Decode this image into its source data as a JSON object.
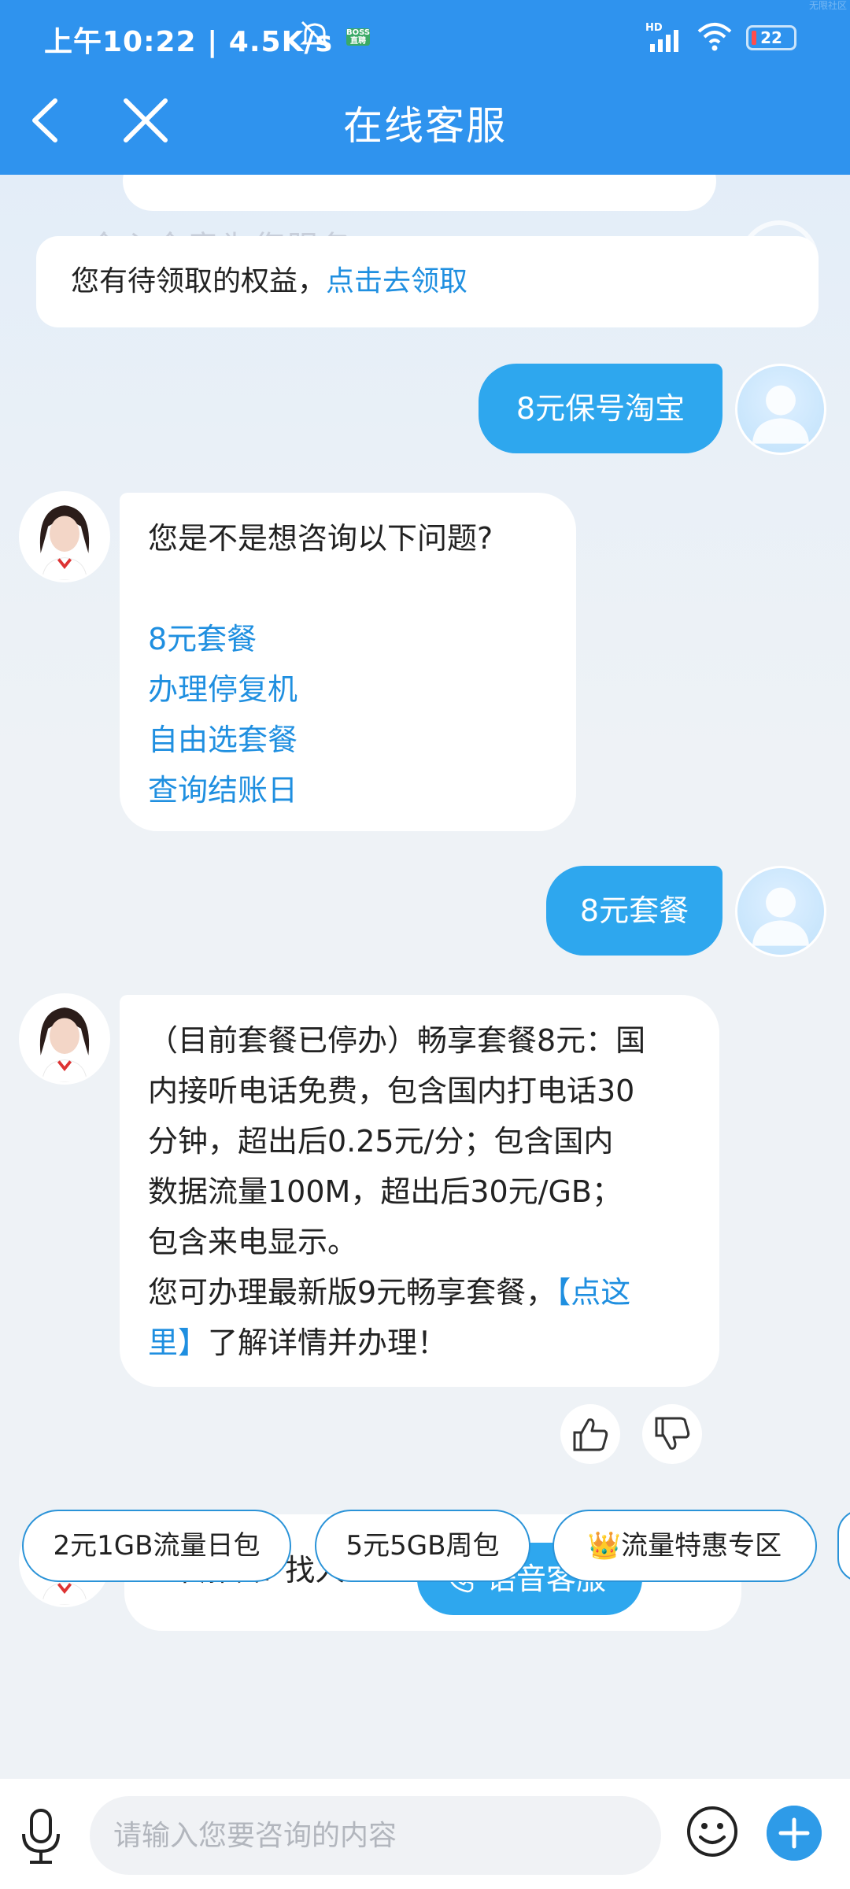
{
  "status_bar": {
    "time": "上午10:22 | 4.5K/s",
    "boss_badge": "BOSS\n直聘",
    "network_label": "HD",
    "battery": "22",
    "watermark": "无限社区"
  },
  "header": {
    "title": "在线客服",
    "back_icon": "chevron-left-icon",
    "close_icon": "close-icon"
  },
  "background_hint": "全心全意为您服务",
  "benefit_banner": {
    "text": "您有待领取的权益，",
    "link": "点击去领取"
  },
  "messages": [
    {
      "type": "user",
      "text": "8元保号淘宝"
    },
    {
      "type": "agent",
      "question": "您是不是想咨询以下问题?",
      "quick_links": [
        "8元套餐",
        "办理停复机",
        "自由选套餐",
        "查询结账日"
      ]
    },
    {
      "type": "user",
      "text": "8元套餐"
    },
    {
      "type": "agent",
      "lines": [
        "（目前套餐已停办）畅享套餐8元：国",
        "内接听电话免费，包含国内打电话30",
        "分钟，超出后0.25元/分；包含国内",
        "数据流量100M，超出后30元/GB；",
        "包含来电显示。",
        "您可办理最新版9元畅享套餐，"
      ],
      "link_part1": "【点这",
      "link_part2": "里】",
      "tail": "了解详情并办理！"
    },
    {
      "type": "agent_escalate",
      "text": "未解决? 找人工",
      "button": "语音客服"
    }
  ],
  "feedback": {
    "like_icon": "thumbs-up-icon",
    "dislike_icon": "thumbs-down-icon"
  },
  "quick_chips": [
    "2元1GB流量日包",
    "5元5GB周包",
    "👑流量特惠专区"
  ],
  "input_bar": {
    "placeholder": "请输入您要咨询的内容",
    "mic_icon": "microphone-icon",
    "emoji_icon": "smiley-icon",
    "plus_icon": "plus-icon"
  },
  "colors": {
    "primary": "#2f93ee",
    "bubble_out": "#2ea7ee",
    "link": "#1f8fe0"
  }
}
